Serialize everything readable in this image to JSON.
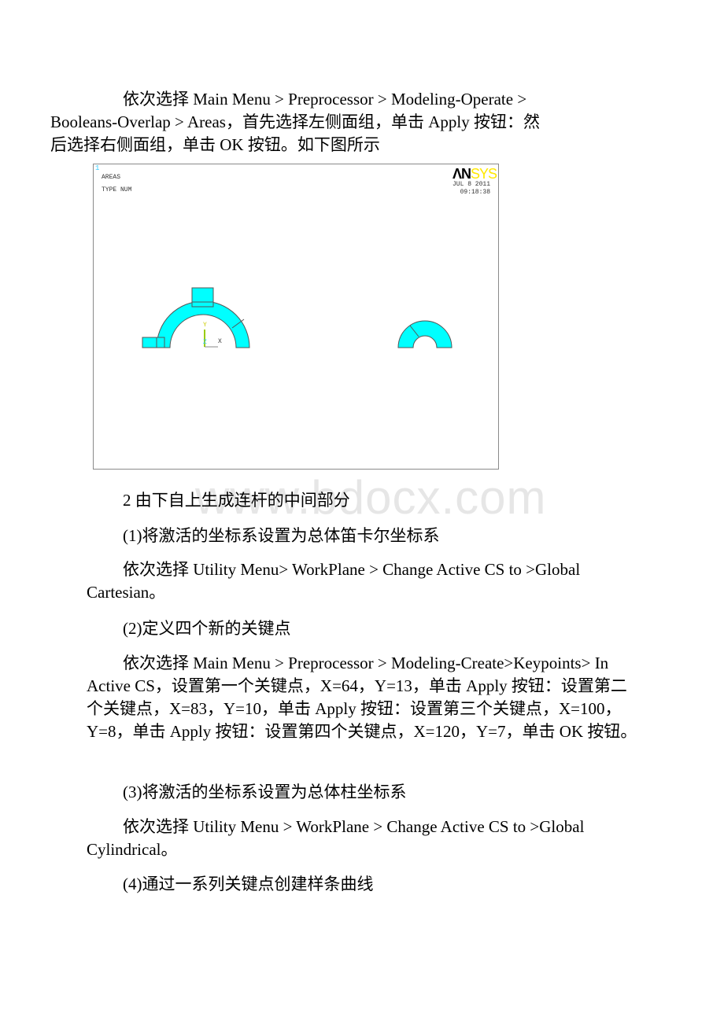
{
  "watermark": "www.bdocx.com",
  "paragraphs": {
    "p1_line1": "依次选择 Main Menu > Preprocessor >  Modeling-Operate >",
    "p1_line2": "Booleans-Overlap > Areas，首先选择左侧面组，单击 Apply 按钮：然",
    "p1_line3": "后选择右侧面组，单击 OK 按钮。如下图所示",
    "section2": "2 由下自上生成连杆的中间部分",
    "step1_title": "(1)将激活的坐标系设置为总体笛卡尔坐标系",
    "step1_body": " 依次选择 Utility Menu> WorkPlane > Change Active CS to >Global Cartesian。",
    "step2_title": "(2)定义四个新的关键点",
    "step2_body": " 依次选择 Main Menu > Preprocessor > Modeling-Create>Keypoints> In Active CS，设置第一个关键点，X=64，Y=13，单击 Apply 按钮：设置第二个关键点，X=83，Y=10，单击 Apply 按钮：设置第三个关键点，X=100，Y=8，单击 Apply 按钮：设置第四个关键点，X=120，Y=7，单击 OK 按钮。",
    "step3_title": "(3)将激活的坐标系设置为总体柱坐标系",
    "step3_body": "依次选择 Utility Menu > WorkPlane > Change Active CS to >Global Cylindrical。",
    "step4_title": " (4)通过一系列关键点创建样条曲线"
  },
  "figure": {
    "window_number": "1",
    "label_areas": "AREAS",
    "label_type": "TYPE NUM",
    "logo_an": "ΛN",
    "logo_sys": "SYS",
    "date": "JUL  8 2011",
    "time": "09:18:38",
    "axis_y": "Y",
    "axis_z": "Z",
    "axis_x": "X",
    "area_fill": "#00ffff",
    "area_stroke": "#555555"
  }
}
